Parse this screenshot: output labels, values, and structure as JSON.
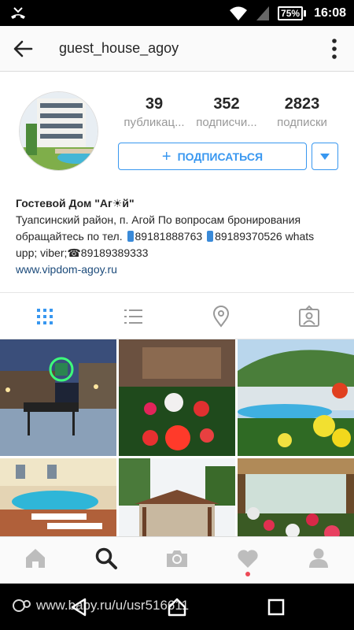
{
  "status_bar": {
    "battery": "75%",
    "time": "16:08"
  },
  "header": {
    "username": "guest_house_agoy"
  },
  "profile": {
    "stats": [
      {
        "value": "39",
        "label": "публикац..."
      },
      {
        "value": "352",
        "label": "подписчи..."
      },
      {
        "value": "2823",
        "label": "подписки"
      }
    ],
    "follow_label": "ПОДПИСАТЬСЯ",
    "bio": {
      "name": "Гостевой Дом \"Аг☀й\"",
      "line1": "Туапсинский район, п. Агой По вопросам бронирования",
      "line2a": "обращайтесь по тел.",
      "phone1": "89181888763",
      "phone2": "89189370526 whats",
      "line3": "upp; viber;☎89189389333",
      "website": "www.vipdom-agoy.ru"
    }
  },
  "view_tabs": [
    "grid",
    "list",
    "location",
    "tagged"
  ],
  "grid_posts": [
    {
      "alt": "courtyard-night"
    },
    {
      "alt": "flowers-garden"
    },
    {
      "alt": "pool-hills"
    },
    {
      "alt": "pool-deck"
    },
    {
      "alt": "gazebo"
    },
    {
      "alt": "flower-terrace"
    }
  ],
  "bottom_nav": [
    "home",
    "search",
    "camera",
    "activity",
    "profile"
  ],
  "watermark": "www.baby.ru/u/usr516611",
  "colors": {
    "accent": "#3897f0",
    "link": "#1b4a7a",
    "notification": "#ed4956"
  }
}
